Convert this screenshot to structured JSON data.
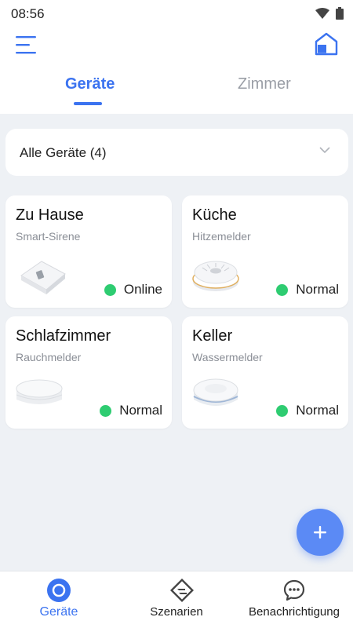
{
  "status_bar": {
    "time": "08:56"
  },
  "tabs": [
    {
      "label": "Geräte",
      "active": true
    },
    {
      "label": "Zimmer",
      "active": false
    }
  ],
  "filter": {
    "label": "Alle Geräte (4)"
  },
  "devices": [
    {
      "name": "Zu Hause",
      "type": "Smart-Sirene",
      "status": "Online",
      "status_color": "#2ecc71",
      "icon": "smart-siren-device"
    },
    {
      "name": "Küche",
      "type": "Hitzemelder",
      "status": "Normal",
      "status_color": "#2ecc71",
      "icon": "heat-detector-device"
    },
    {
      "name": "Schlafzimmer",
      "type": "Rauchmelder",
      "status": "Normal",
      "status_color": "#2ecc71",
      "icon": "smoke-detector-device"
    },
    {
      "name": "Keller",
      "type": "Wassermelder",
      "status": "Normal",
      "status_color": "#2ecc71",
      "icon": "water-detector-device"
    }
  ],
  "bottom_nav": [
    {
      "label": "Geräte",
      "icon": "devices-icon",
      "active": true
    },
    {
      "label": "Szenarien",
      "icon": "scenes-icon",
      "active": false
    },
    {
      "label": "Benachrichtigung",
      "icon": "notifications-icon",
      "active": false
    }
  ],
  "colors": {
    "accent": "#3b73f0",
    "fab": "#5b8af5",
    "online": "#2ecc71",
    "background": "#eef1f5"
  }
}
